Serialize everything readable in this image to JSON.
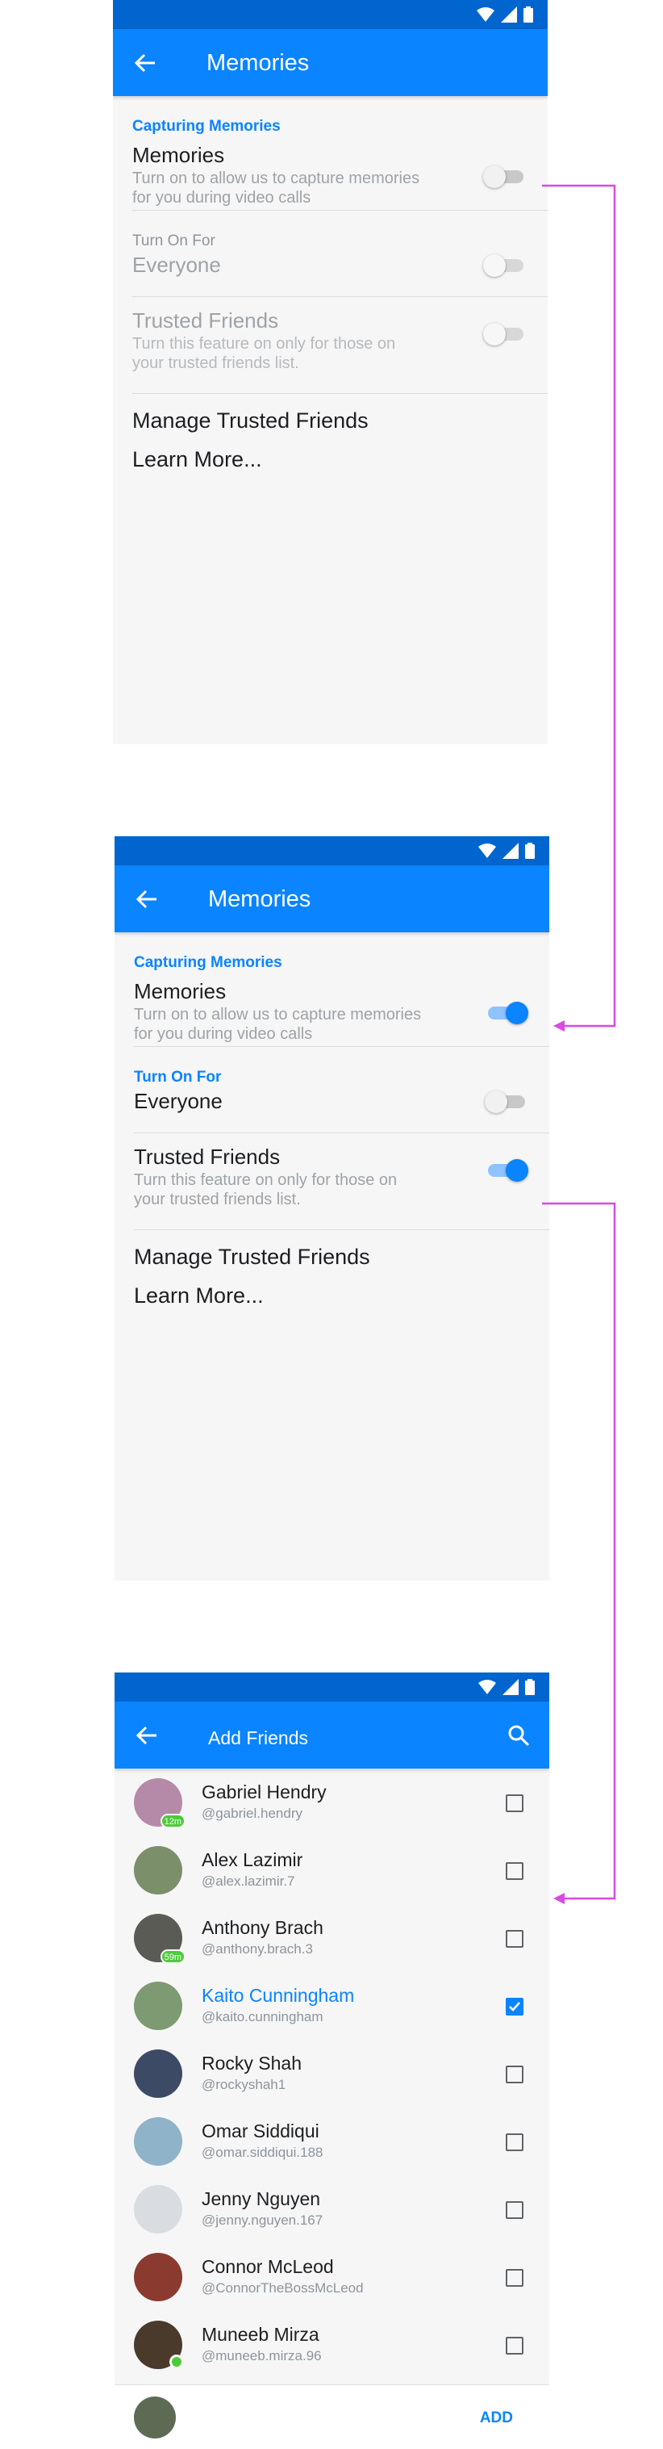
{
  "colors": {
    "accent": "#0a84ff",
    "statusbar": "#0065cf",
    "arrow": "#d84be0"
  },
  "screen1": {
    "title": "Memories",
    "section": "Capturing Memories",
    "memories": {
      "label": "Memories",
      "sub": "Turn on to allow us to capture memories for you during video calls",
      "on": false
    },
    "turn_on_for": "Turn On For",
    "everyone": {
      "label": "Everyone",
      "on": false,
      "disabled": true
    },
    "trusted": {
      "label": "Trusted Friends",
      "sub": "Turn this feature on only for those on your trusted friends list.",
      "on": false,
      "disabled": true
    },
    "manage": "Manage Trusted Friends",
    "learn": "Learn More..."
  },
  "screen2": {
    "title": "Memories",
    "section": "Capturing Memories",
    "memories": {
      "label": "Memories",
      "sub": "Turn on to allow us to capture memories for you during video calls",
      "on": true
    },
    "turn_on_for": "Turn On For",
    "everyone": {
      "label": "Everyone",
      "on": false
    },
    "trusted": {
      "label": "Trusted Friends",
      "sub": "Turn this feature on only for those on your trusted friends list.",
      "on": true
    },
    "manage": "Manage Trusted Friends",
    "learn": "Learn More..."
  },
  "screen3": {
    "title": "Add Friends",
    "friends": [
      {
        "name": "Gabriel Hendry",
        "handle": "@gabriel.hendry",
        "badge": "12m",
        "checked": false,
        "avatar_color": "#b58aa8"
      },
      {
        "name": "Alex Lazimir",
        "handle": "@alex.lazimir.7",
        "badge": "",
        "checked": false,
        "avatar_color": "#7a8f6a"
      },
      {
        "name": "Anthony Brach",
        "handle": "@anthony.brach.3",
        "badge": "59m",
        "checked": false,
        "avatar_color": "#5b5b55"
      },
      {
        "name": "Kaito Cunningham",
        "handle": "@kaito.cunningham",
        "badge": "",
        "checked": true,
        "avatar_color": "#7e9a72"
      },
      {
        "name": "Rocky Shah",
        "handle": "@rockyshah1",
        "badge": "",
        "checked": false,
        "avatar_color": "#3d4a66"
      },
      {
        "name": "Omar Siddiqui",
        "handle": "@omar.siddiqui.188",
        "badge": "",
        "checked": false,
        "avatar_color": "#8fb3c8"
      },
      {
        "name": "Jenny Nguyen",
        "handle": "@jenny.nguyen.167",
        "badge": "",
        "checked": false,
        "avatar_color": "#d9dce1"
      },
      {
        "name": "Connor McLeod",
        "handle": "@ConnorTheBossMcLeod",
        "badge": "",
        "checked": false,
        "avatar_color": "#8a3a2e"
      },
      {
        "name": "Muneeb Mirza",
        "handle": "@muneeb.mirza.96",
        "badge": "",
        "checked": false,
        "avatar_color": "#4a3a2c",
        "online": true
      }
    ],
    "bottom_avatar_color": "#5d6b55",
    "add_label": "ADD"
  }
}
